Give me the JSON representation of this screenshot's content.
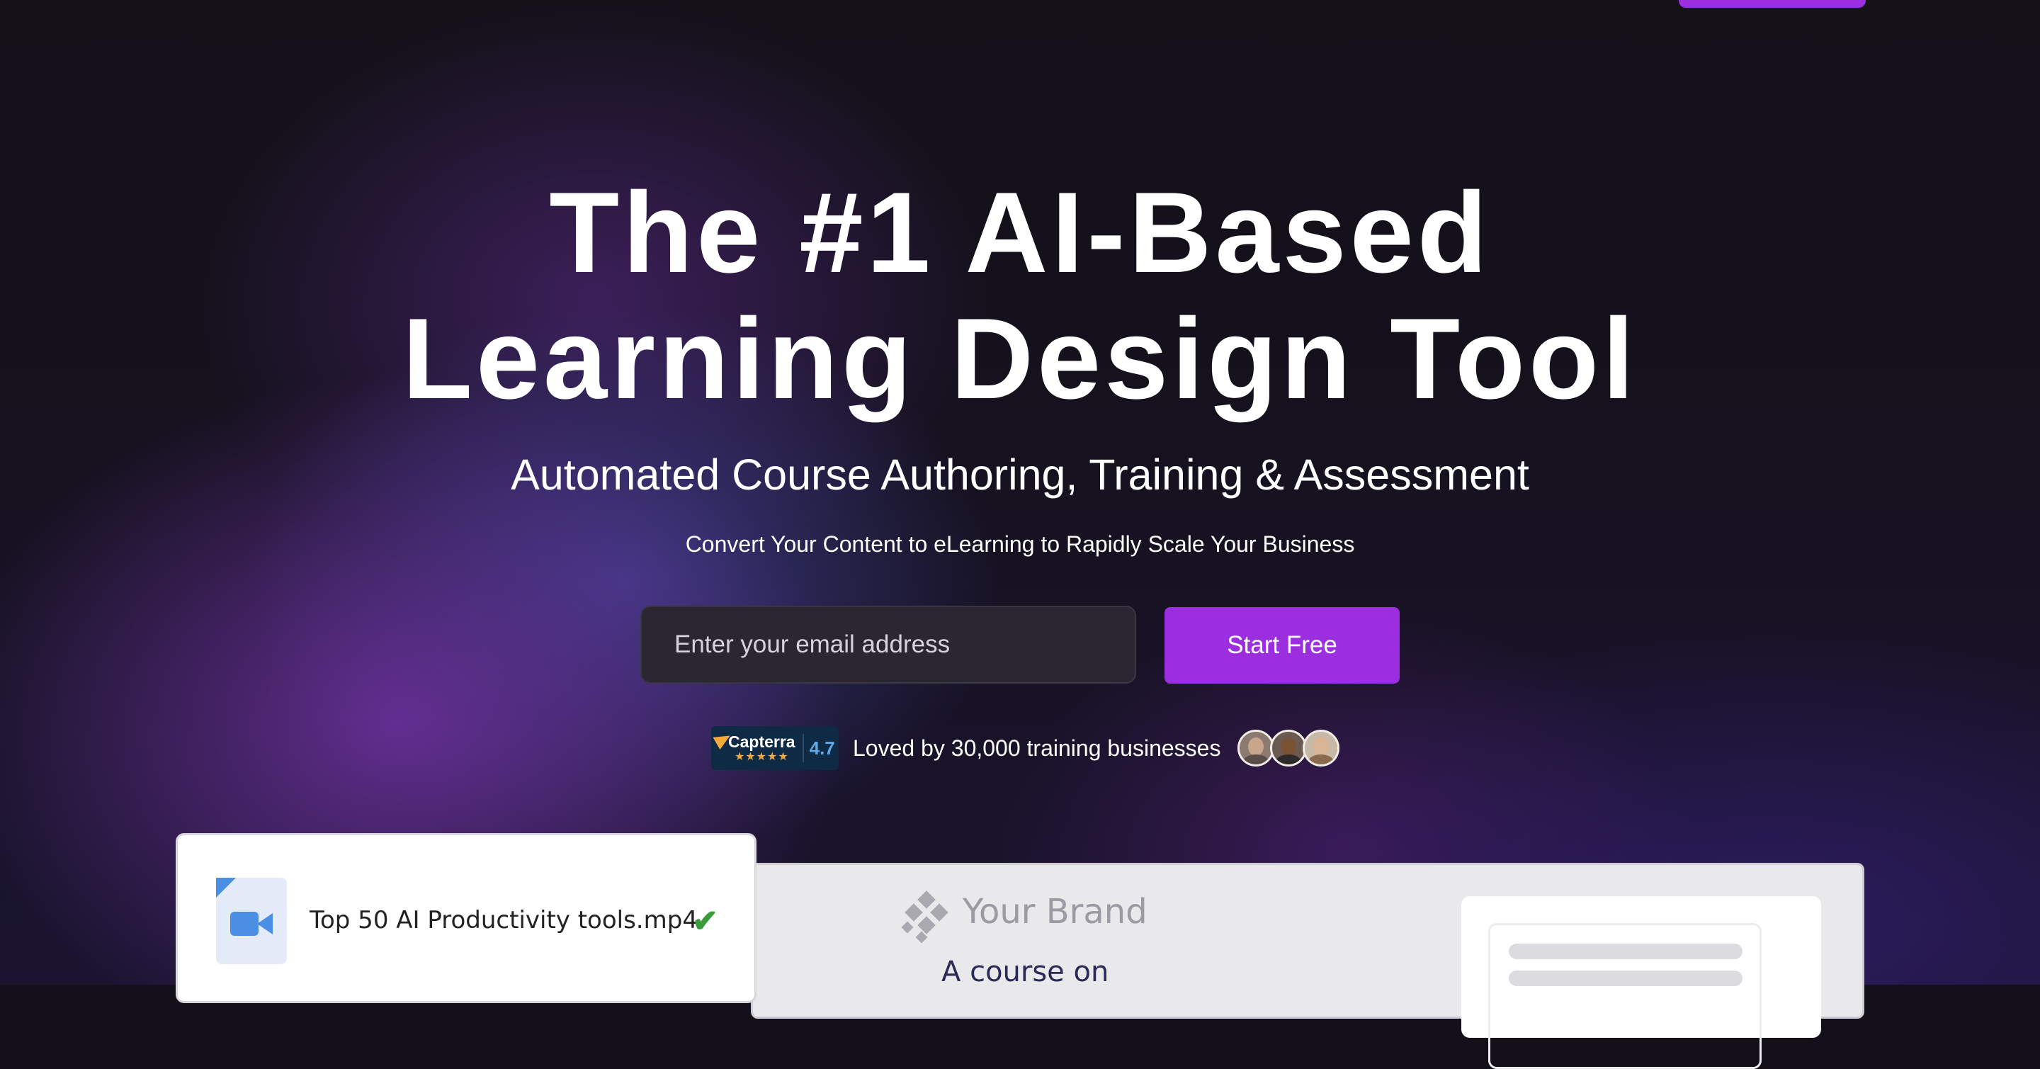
{
  "hero": {
    "headline_line1": "The #1 AI-Based",
    "headline_line2": "Learning Design Tool",
    "subheadline": "Automated Course Authoring, Training & Assessment",
    "tagline": "Convert Your Content to eLearning to Rapidly Scale Your Business"
  },
  "signup": {
    "email_placeholder": "Enter your email address",
    "cta_label": "Start Free"
  },
  "social_proof": {
    "capterra_name": "Capterra",
    "capterra_stars": "★★★★★",
    "capterra_rating": "4.7",
    "loved_text": "Loved by 30,000 training businesses"
  },
  "preview": {
    "file_name": "Top 50 AI Productivity tools.mp4",
    "check_symbol": "✔",
    "brand_name": "Your Brand",
    "course_title": "A course on"
  },
  "colors": {
    "accent": "#9b2fe0",
    "background": "#131019",
    "input_bg": "#2a2733",
    "capterra_bg": "#0f2a45",
    "capterra_orange": "#f6a93b",
    "check_green": "#3a9b3a"
  },
  "icons": [
    "capterra-logo-icon",
    "video-file-icon",
    "checkmark-icon",
    "brand-logo-icon",
    "avatar"
  ]
}
